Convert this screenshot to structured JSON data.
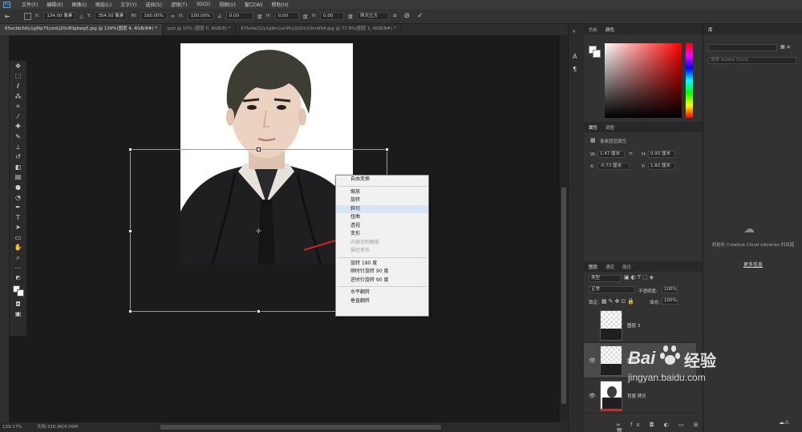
{
  "menubar": {
    "logo": "Ps",
    "items": [
      "文件(F)",
      "编辑(E)",
      "图像(I)",
      "图层(L)",
      "文字(Y)",
      "选择(S)",
      "滤镜(T)",
      "3D(D)",
      "视图(V)",
      "窗口(W)",
      "帮助(H)"
    ]
  },
  "options": {
    "x_label": "X:",
    "x_value": "134.00 像素",
    "y_label": "Y:",
    "y_value": "354.50 像素",
    "w_label": "W:",
    "w_value": "100.00%",
    "h_label": "H:",
    "h_value": "100.00%",
    "angle_value": "0.00",
    "hskew_label": "H:",
    "hskew_value": "0.00",
    "vskew_label": "V:",
    "vskew_value": "0.00",
    "interp_value": "两次立方"
  },
  "tabs": [
    {
      "label": "65ecbb3dly1g9lp75yznkj20c80gbwg5.jpg @ 139%(图层 4, RGB/8#) *",
      "active": true
    },
    {
      "label": "psd @ 10% (图层 0, RGB/8) *",
      "active": false
    },
    {
      "label": "67fe4e21ly1g9m1ar95y2j20n10mldfj4.jpg @ 77.8%(图层 1, RGB/8#) *",
      "active": false
    }
  ],
  "context_menu": {
    "items": [
      {
        "label": "自由变换",
        "enabled": true
      },
      {
        "sep": true
      },
      {
        "label": "缩放",
        "enabled": true
      },
      {
        "label": "旋转",
        "enabled": true
      },
      {
        "label": "斜切",
        "enabled": true,
        "highlight": true
      },
      {
        "label": "扭曲",
        "enabled": true
      },
      {
        "label": "透视",
        "enabled": true
      },
      {
        "label": "变形",
        "enabled": true
      },
      {
        "label": "内容识别缩放",
        "enabled": false
      },
      {
        "label": "操控变形",
        "enabled": false
      },
      {
        "sep": true
      },
      {
        "label": "旋转 180 度",
        "enabled": true
      },
      {
        "label": "顺时针旋转 90 度",
        "enabled": true
      },
      {
        "label": "逆时针旋转 90 度",
        "enabled": true
      },
      {
        "sep": true
      },
      {
        "label": "水平翻转",
        "enabled": true
      },
      {
        "label": "垂直翻转",
        "enabled": true
      }
    ]
  },
  "status": {
    "zoom": "139.17%",
    "doc": "文档:316.9K/4.05M"
  },
  "color_panel": {
    "tab1": "色板",
    "tab2": "颜色"
  },
  "properties_panel": {
    "tab1": "属性",
    "tab2": "调整",
    "subtitle": "像素图层属性",
    "w_label": "W:",
    "w_value": "1.47 厘米",
    "h_label": "H:",
    "h_value": "0.93 厘米",
    "x_label": "X:",
    "x_value": "-0.73 厘米",
    "y_label": "Y:",
    "y_value": "1.82 厘米"
  },
  "layers_panel": {
    "tab1": "图层",
    "tab2": "通道",
    "tab3": "路径",
    "filter": "类型",
    "blend_mode": "正常",
    "opacity_label": "不透明度:",
    "opacity_value": "100%",
    "lock_label": "锁定:",
    "fill_label": "填充:",
    "fill_value": "100%",
    "layers": [
      {
        "name": "图层 3",
        "visible": false,
        "selected": false
      },
      {
        "name": "图层 4",
        "visible": true,
        "selected": true
      },
      {
        "name": "背景 拷贝",
        "visible": true,
        "selected": false
      }
    ]
  },
  "library_panel": {
    "tab": "库",
    "search_placeholder": "搜索 Adobe Stock",
    "message": "初始化 Creative Cloud Libraries 时出错",
    "link": "更多信息"
  },
  "watermark": {
    "brand": "Bai",
    "brand_cn": "经验",
    "url": "jingyan.baidu.com"
  },
  "colors": {
    "accent": "#4aa3ff",
    "menu_bg": "#f1f1f1",
    "panel_bg": "#323232",
    "canvas_bg": "#1b1b1b",
    "red_arrow": "#e02020",
    "baidu_blue": "#2a66d8"
  }
}
